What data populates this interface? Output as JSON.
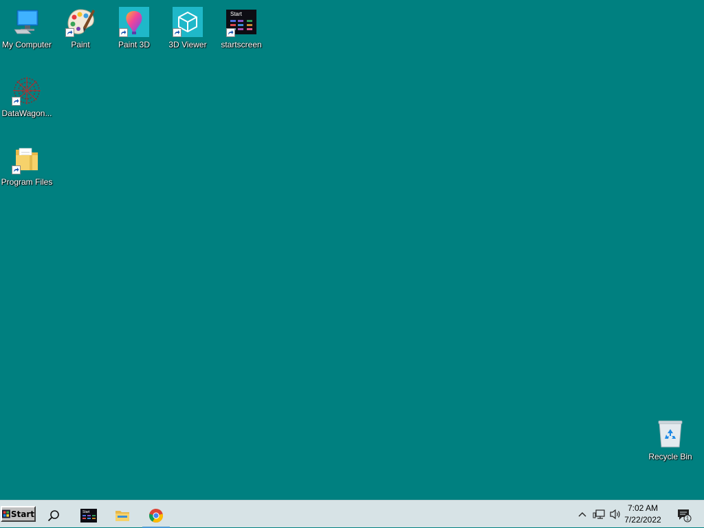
{
  "desktop": {
    "background_color": "#008080",
    "icons": [
      {
        "label": "My Computer",
        "icon": "computer-icon"
      },
      {
        "label": "Paint",
        "icon": "paint-palette-icon"
      },
      {
        "label": "Paint 3D",
        "icon": "paint3d-icon"
      },
      {
        "label": "3D Viewer",
        "icon": "3d-viewer-icon"
      },
      {
        "label": "startscreen",
        "icon": "startscreen-icon",
        "thumb_text": "Start"
      },
      {
        "label": "DataWagon...",
        "icon": "datawagon-icon"
      },
      {
        "label": "Program Files",
        "icon": "folder-icon"
      },
      {
        "label": "Recycle Bin",
        "icon": "recycle-bin-icon"
      }
    ]
  },
  "taskbar": {
    "start_label": "Start",
    "pinned": [
      {
        "name": "search",
        "icon": "search-icon"
      },
      {
        "name": "startscreen",
        "icon": "startscreen-taskbar-icon",
        "thumb_text": "Start"
      },
      {
        "name": "file-explorer",
        "icon": "file-explorer-icon"
      },
      {
        "name": "chrome",
        "icon": "chrome-icon",
        "active": true
      }
    ],
    "tray": {
      "icons": [
        "chevron-up-icon",
        "network-icon",
        "volume-icon"
      ],
      "time": "7:02 AM",
      "date": "7/22/2022",
      "notification_count": "1"
    }
  }
}
